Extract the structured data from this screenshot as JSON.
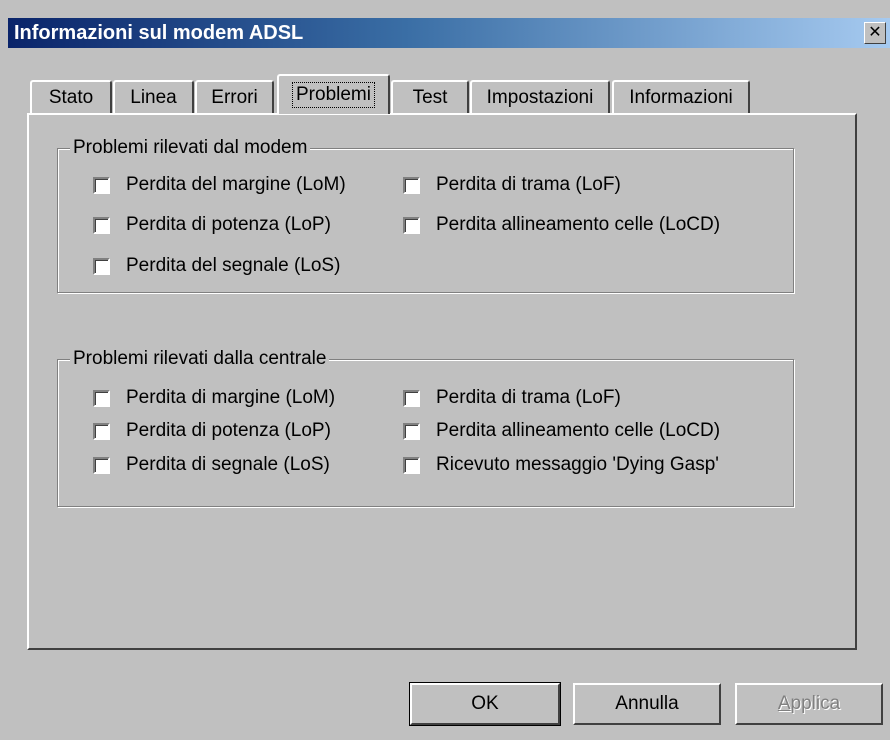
{
  "window": {
    "title": "Informazioni sul modem ADSL",
    "close_glyph": "✕"
  },
  "tabs": [
    {
      "label": "Stato",
      "active": false
    },
    {
      "label": "Linea",
      "active": false
    },
    {
      "label": "Errori",
      "active": false
    },
    {
      "label": "Problemi",
      "active": true
    },
    {
      "label": "Test",
      "active": false
    },
    {
      "label": "Impostazioni",
      "active": false
    },
    {
      "label": "Informazioni",
      "active": false
    }
  ],
  "group_modem": {
    "legend": "Problemi rilevati dal modem",
    "items": [
      {
        "label": "Perdita del margine (LoM)",
        "checked": false
      },
      {
        "label": "Perdita di trama (LoF)",
        "checked": false
      },
      {
        "label": "Perdita di potenza (LoP)",
        "checked": false
      },
      {
        "label": "Perdita allineamento celle (LoCD)",
        "checked": false
      },
      {
        "label": "Perdita del segnale (LoS)",
        "checked": false
      }
    ]
  },
  "group_central": {
    "legend": "Problemi rilevati dalla centrale",
    "items": [
      {
        "label": "Perdita di margine (LoM)",
        "checked": false
      },
      {
        "label": "Perdita di trama (LoF)",
        "checked": false
      },
      {
        "label": "Perdita di potenza (LoP)",
        "checked": false
      },
      {
        "label": "Perdita allineamento celle (LoCD)",
        "checked": false
      },
      {
        "label": "Perdita di segnale (LoS)",
        "checked": false
      },
      {
        "label": "Ricevuto messaggio 'Dying Gasp'",
        "checked": false
      }
    ]
  },
  "buttons": {
    "ok": "OK",
    "cancel": "Annulla",
    "apply": "Applica"
  }
}
